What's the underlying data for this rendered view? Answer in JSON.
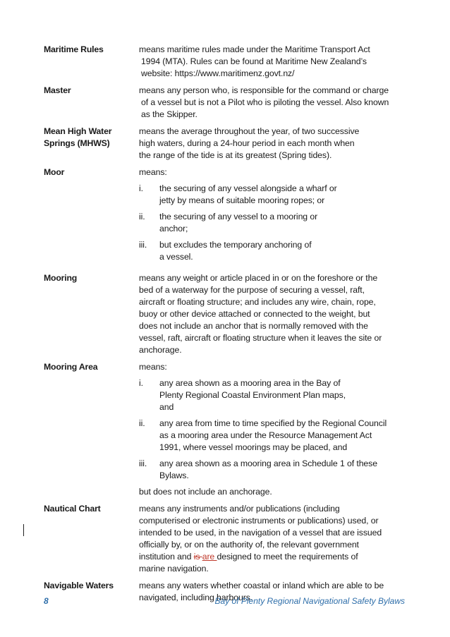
{
  "definitions": {
    "maritime_rules": {
      "term": "Maritime Rules",
      "lines": [
        "means maritime rules made under the Maritime Transport Act",
        "1994 (MTA). Rules can be found at Maritime New Zealand’s",
        "website: https://www.maritimenz.govt.nz/"
      ]
    },
    "master": {
      "term": "Master",
      "lines": [
        "means any person who, is responsible for the command or charge",
        "of a vessel but is not a Pilot who is piloting the vessel. Also known",
        "as the Skipper."
      ]
    },
    "mhws": {
      "term_line1": "Mean High Water",
      "term_line2": "Springs (MHWS)",
      "lines": [
        "means the average throughout the year, of two successive",
        "high waters, during a 24-hour period in each month when",
        "the range of the tide is at its greatest (Spring tides)."
      ]
    },
    "moor": {
      "term": "Moor",
      "intro": "means:",
      "items": [
        {
          "num": "i.",
          "line1": "the securing of any vessel alongside a wharf or",
          "line2": "jetty by means of suitable mooring ropes; or"
        },
        {
          "num": "ii.",
          "line1": "the securing of any vessel to a mooring or",
          "line2": "anchor;"
        },
        {
          "num": "iii.",
          "line1": "but excludes the temporary anchoring of",
          "line2": "a vessel."
        }
      ]
    },
    "mooring": {
      "term": "Mooring",
      "lines": [
        "means any weight or article placed in or on the foreshore or the",
        "bed of a waterway for the purpose of securing a vessel, raft,",
        "aircraft or floating structure; and includes any wire, chain, rope,",
        "buoy or other device attached or connected to the weight, but",
        "does not include an anchor that is normally removed with the",
        "vessel, raft, aircraft or floating structure when it leaves the site or",
        "anchorage."
      ]
    },
    "mooring_area": {
      "term": "Mooring Area",
      "intro": "means:",
      "items": [
        {
          "num": "i.",
          "line1": "any area shown as a mooring area in the Bay of",
          "line2": "Plenty Regional Coastal Environment Plan maps,",
          "line3": "and"
        },
        {
          "num": "ii.",
          "line1": "any area from time to time specified by the Regional Council",
          "line2": "as a mooring area under the Resource Management Act",
          "line3": "1991, where vessel moorings may be placed, and"
        },
        {
          "num": "iii.",
          "line1": "any area shown as a mooring area in Schedule 1 of these",
          "line2": "Bylaws."
        }
      ],
      "outro": "but does not include an anchorage."
    },
    "nautical_chart": {
      "term": "Nautical Chart",
      "lines": [
        "means any instruments and/or publications (including",
        "computerised or electronic instruments or publications) used, or",
        "intended to be used, in the navigation of a vessel that are issued",
        "officially by, or on the authority of, the relevant government"
      ],
      "line5_before": "institution and ",
      "deleted": "is ",
      "inserted": "are ",
      "line5_after": "designed to meet the requirements of",
      "line6": "marine navigation."
    },
    "navigable_waters": {
      "term": "Navigable Waters",
      "lines": [
        "means any waters whether coastal or inland which are able to be",
        "navigated, including harbours."
      ]
    }
  },
  "footer": {
    "page_number": "8",
    "title": "Bay of Plenty Regional Navigational Safety Bylaws"
  },
  "colors": {
    "footer": "#2f6faa",
    "tracked_change": "#c0392b"
  }
}
